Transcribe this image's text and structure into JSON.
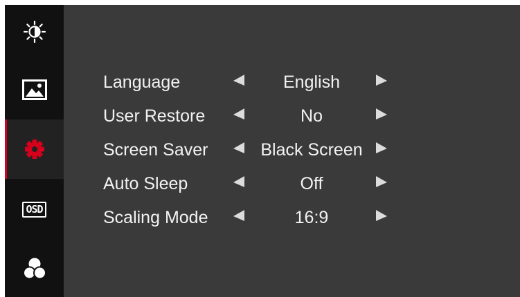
{
  "sidebar": {
    "items": [
      {
        "name": "brightness-contrast",
        "icon": "brightness-contrast-icon"
      },
      {
        "name": "image",
        "icon": "image-icon"
      },
      {
        "name": "setup",
        "icon": "gear-icon",
        "active": true
      },
      {
        "name": "osd",
        "icon": "osd-icon",
        "text": "OSD"
      },
      {
        "name": "color",
        "icon": "color-circles-icon"
      }
    ]
  },
  "settings": [
    {
      "label": "Language",
      "value": "English"
    },
    {
      "label": "User Restore",
      "value": "No"
    },
    {
      "label": "Screen Saver",
      "value": "Black Screen"
    },
    {
      "label": "Auto Sleep",
      "value": "Off"
    },
    {
      "label": "Scaling Mode",
      "value": "16:9"
    }
  ],
  "colors": {
    "background": "#3a3a3a",
    "sidebar": "#111111",
    "accent": "#d6001c",
    "text": "#f2f2f2"
  }
}
